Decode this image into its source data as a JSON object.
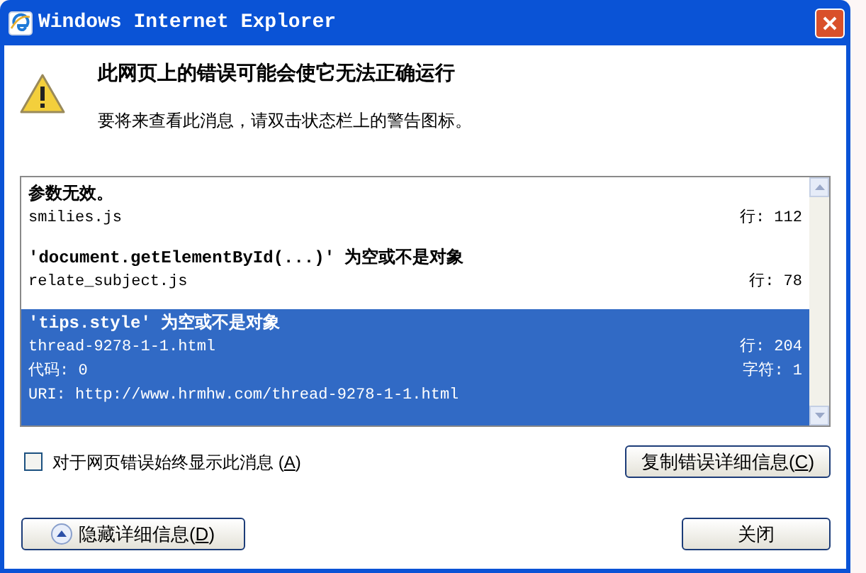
{
  "window": {
    "title": "Windows Internet Explorer"
  },
  "heading": "此网页上的错误可能会使它无法正确运行",
  "hint": "要将来查看此消息，请双击状态栏上的警告图标。",
  "errors": [
    {
      "message": "参数无效。",
      "file": "smilies.js",
      "line": "行: 112",
      "selected": false
    },
    {
      "message": "'document.getElementById(...)' 为空或不是对象",
      "file": "relate_subject.js",
      "line": "行: 78",
      "selected": false
    },
    {
      "message": "'tips.style' 为空或不是对象",
      "file": "thread-9278-1-1.html",
      "line": "行: 204",
      "code": "代码: 0",
      "char": "字符: 1",
      "uri": "URI: http://www.hrmhw.com/thread-9278-1-1.html",
      "selected": true
    }
  ],
  "always_show": {
    "label_before": "对于网页错误始终显示此消息 (",
    "access_key": "A",
    "label_after": ")",
    "checked": false
  },
  "buttons": [
    {
      "kind": "copy",
      "label_before": "复制错误详细信息(",
      "access_key": "C",
      "label_after": ")"
    },
    {
      "kind": "hide",
      "label_before": "隐藏详细信息(",
      "access_key": "D",
      "label_after": ")"
    },
    {
      "kind": "close",
      "label_before": "关闭"
    }
  ]
}
